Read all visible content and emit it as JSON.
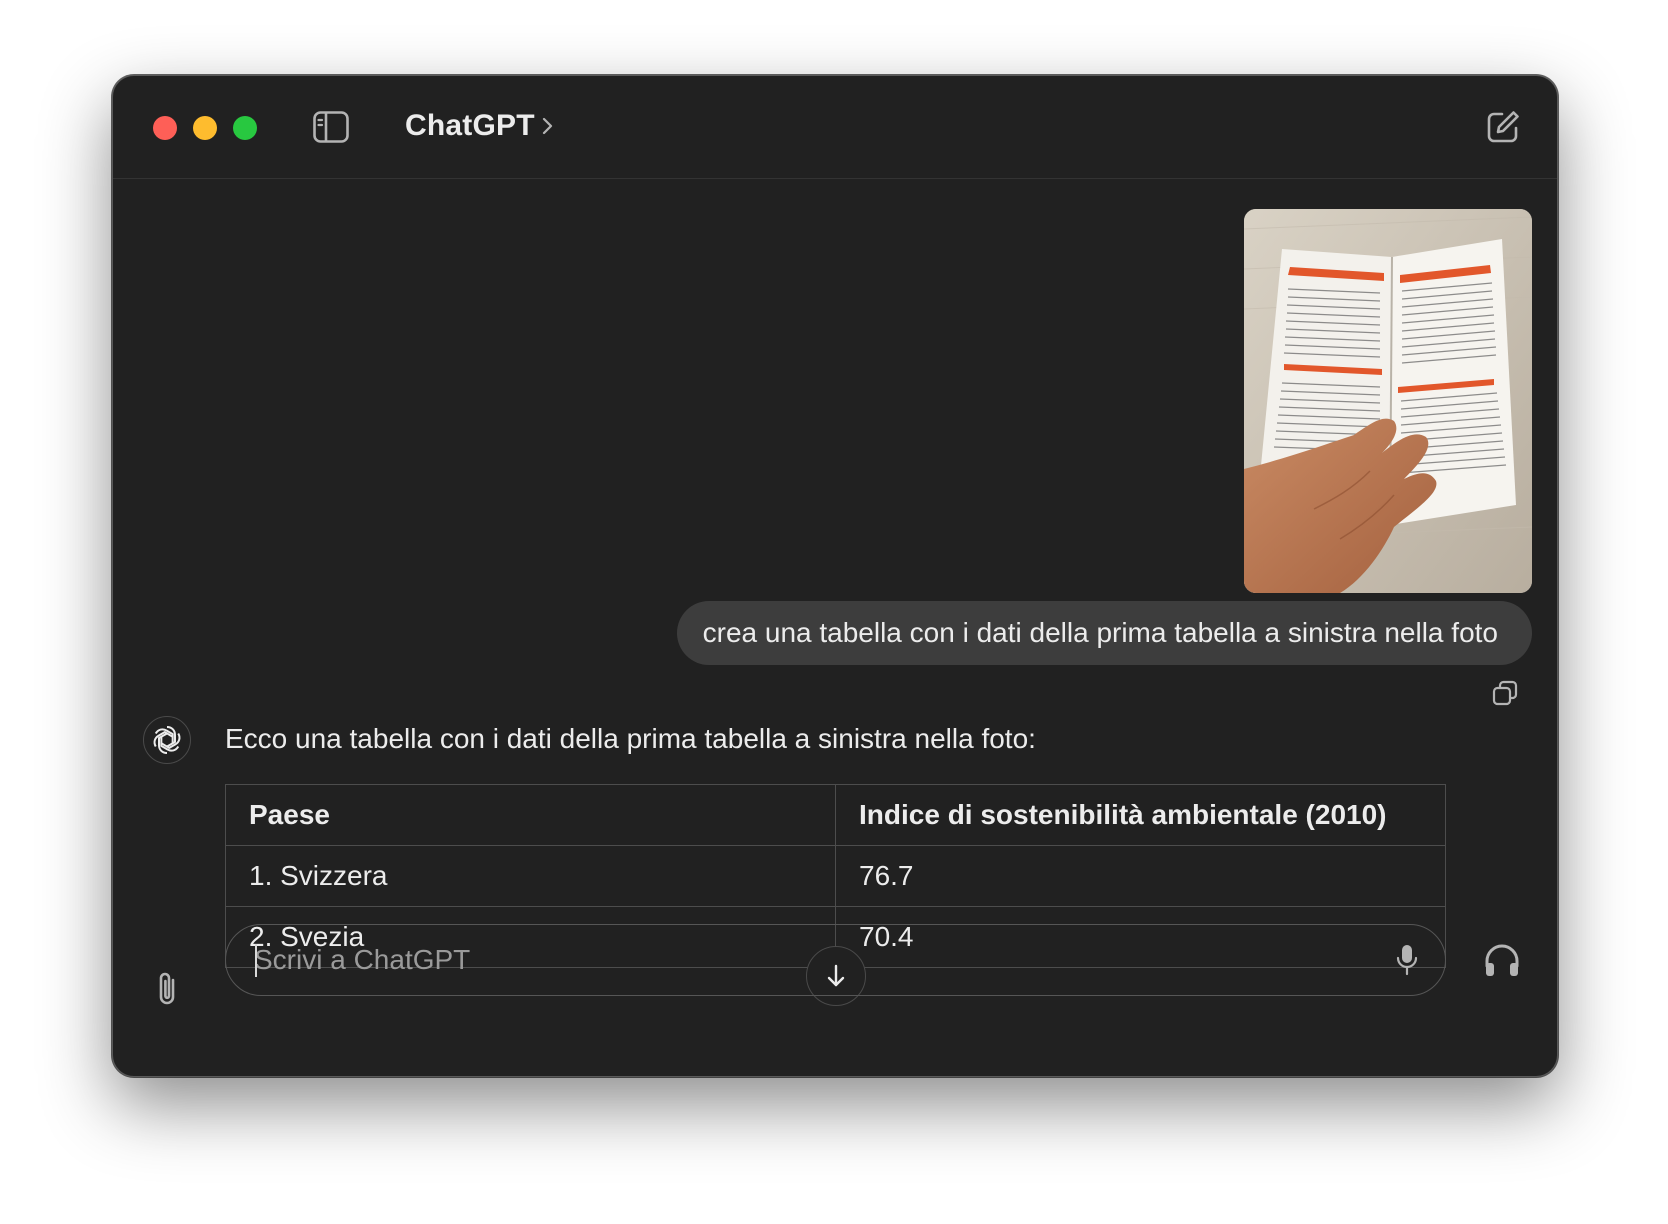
{
  "window": {
    "title": "ChatGPT",
    "traffic_lights": [
      "close",
      "minimize",
      "zoom"
    ],
    "colors": {
      "close": "#fe5f57",
      "minimize": "#febc2e",
      "zoom": "#28c840",
      "background": "#212121"
    }
  },
  "toolbar": {
    "sidebar_toggle_icon": "sidebar-toggle-icon",
    "title_chevron_icon": "chevron-right-icon",
    "new_chat_icon": "compose-icon"
  },
  "conversation": {
    "user_message": {
      "attachment": "photo of an open book showing tables",
      "text": "crea una tabella con i dati della prima tabella  a sinistra nella foto"
    },
    "assistant_message": {
      "intro": "Ecco una tabella con i dati della prima tabella a sinistra nella foto:",
      "table": {
        "headers": [
          "Paese",
          "Indice di sostenibilità ambientale (2010)"
        ],
        "rows": [
          [
            "1. Svizzera",
            "76.7"
          ],
          [
            "2. Svezia",
            "70.4"
          ]
        ]
      }
    }
  },
  "composer": {
    "placeholder": "Scrivi a ChatGPT",
    "value": "",
    "attach_icon": "paperclip-icon",
    "mic_icon": "microphone-icon",
    "voice_icon": "headphones-icon"
  }
}
